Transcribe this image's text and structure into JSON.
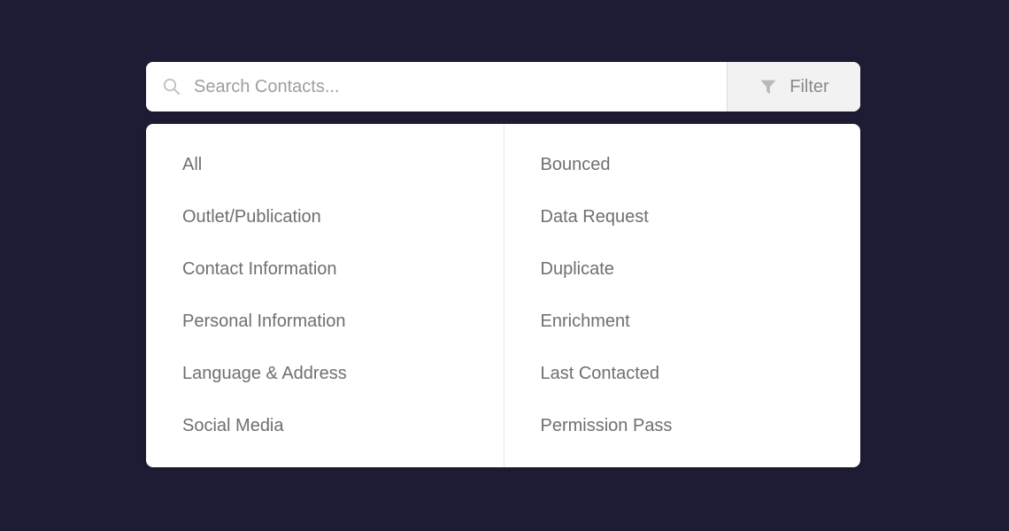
{
  "search": {
    "placeholder": "Search Contacts...",
    "value": "",
    "icon": "search-icon"
  },
  "filter_button": {
    "label": "Filter",
    "icon": "filter-funnel-icon"
  },
  "dropdown": {
    "left_column": [
      {
        "label": "All"
      },
      {
        "label": "Outlet/Publication"
      },
      {
        "label": "Contact Information"
      },
      {
        "label": "Personal Information"
      },
      {
        "label": "Language & Address"
      },
      {
        "label": "Social Media"
      }
    ],
    "right_column": [
      {
        "label": "Bounced"
      },
      {
        "label": "Data Request"
      },
      {
        "label": "Duplicate"
      },
      {
        "label": "Enrichment"
      },
      {
        "label": "Last Contacted"
      },
      {
        "label": "Permission Pass"
      }
    ]
  },
  "colors": {
    "page_background": "#1e1b35",
    "panel_background": "#ffffff",
    "filter_button_background": "#f2f2f2",
    "menu_text": "#6f6f6f",
    "placeholder_text": "#9e9e9e",
    "divider": "#e6e6e6"
  }
}
